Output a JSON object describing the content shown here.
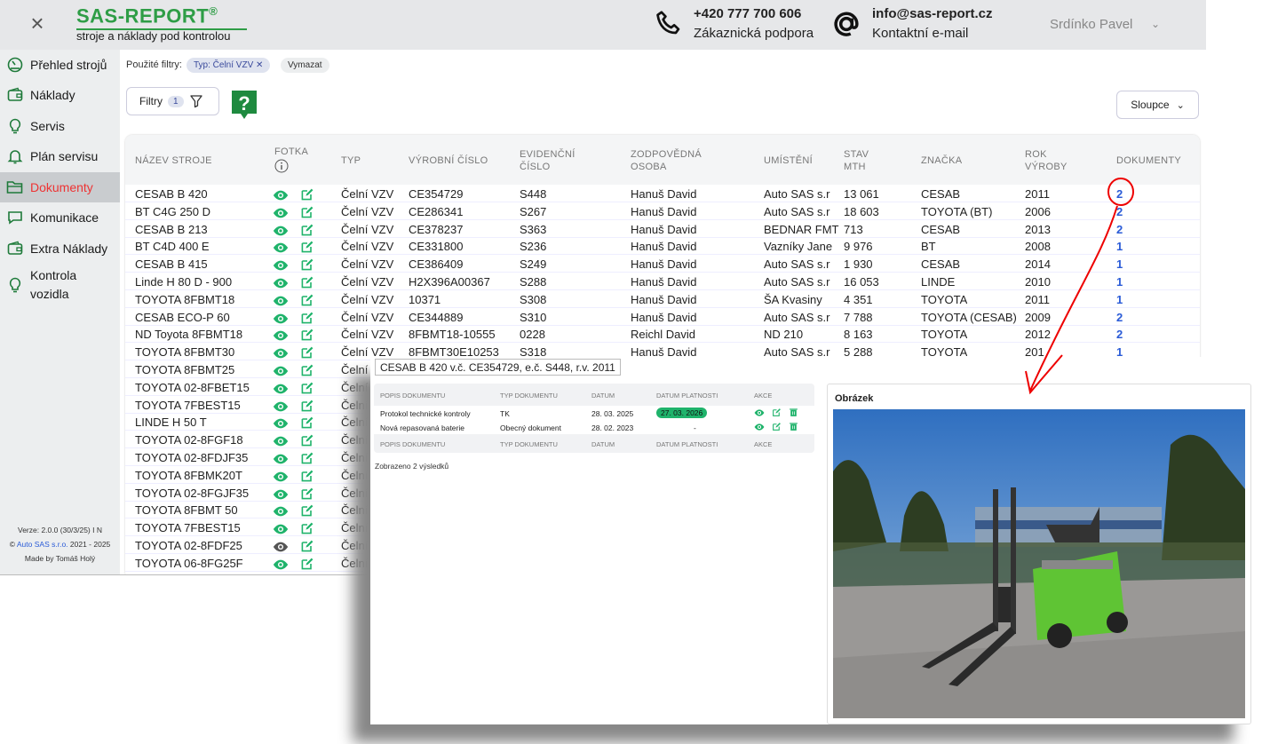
{
  "header": {
    "logo_title": "SAS-REPORT",
    "logo_reg": "®",
    "logo_subtitle": "stroje a náklady pod kontrolou",
    "phone": "+420 777 700 606",
    "phone_label": "Zákaznická podpora",
    "email": "info@sas-report.cz",
    "email_label": "Kontaktní e-mail",
    "user": "Srdínko Pavel"
  },
  "sidebar": {
    "items": [
      {
        "label": "Přehled strojů",
        "icon": "gauge-icon"
      },
      {
        "label": "Náklady",
        "icon": "wallet-icon"
      },
      {
        "label": "Servis",
        "icon": "bulb-icon"
      },
      {
        "label": "Plán servisu",
        "icon": "bell-icon"
      },
      {
        "label": "Dokumenty",
        "icon": "folder-icon",
        "active": true
      },
      {
        "label": "Komunikace",
        "icon": "chat-icon"
      },
      {
        "label": "Extra Náklady",
        "icon": "wallet-icon"
      },
      {
        "label": "Kontrola vozidla",
        "icon": "bulb-icon"
      }
    ],
    "version": "Verze: 2.0.0 (30/3/25) I N",
    "copyright_prefix": "©",
    "copyright_link": "Auto SAS s.r.o.",
    "copyright_years": "2021 - 2025",
    "made_by": "Made by Tomáš Holý"
  },
  "filters": {
    "label": "Použité filtry:",
    "chip": "Typ: Čelní VZV",
    "clear": "Vymazat",
    "button": "Filtry",
    "count": "1",
    "columns_button": "Sloupce"
  },
  "table": {
    "headers": {
      "name": "NÁZEV STROJE",
      "photo": "FOTKA",
      "type": "TYP",
      "serial": "VÝROBNÍ ČÍSLO",
      "evid1": "EVIDENČNÍ",
      "evid2": "ČÍSLO",
      "resp1": "ZODPOVĚDNÁ",
      "resp2": "OSOBA",
      "location": "UMÍSTĚNÍ",
      "mth1": "STAV",
      "mth2": "MTH",
      "brand": "ZNAČKA",
      "year1": "ROK",
      "year2": "VÝROBY",
      "docs": "DOKUMENTY"
    },
    "rows": [
      {
        "name": "CESAB B 420",
        "type": "Čelní VZV",
        "serial": "CE354729",
        "evid": "S448",
        "person": "Hanuš David",
        "location": "Auto SAS s.r",
        "mth": "13 061",
        "brand": "CESAB",
        "year": "2011",
        "docs": "2"
      },
      {
        "name": "BT C4G 250 D",
        "type": "Čelní VZV",
        "serial": "CE286341",
        "evid": "S267",
        "person": "Hanuš David",
        "location": "Auto SAS s.r",
        "mth": "18 603",
        "brand": "TOYOTA (BT)",
        "year": "2006",
        "docs": "2"
      },
      {
        "name": "CESAB B 213",
        "type": "Čelní VZV",
        "serial": "CE378237",
        "evid": "S363",
        "person": "Hanuš David",
        "location": "BEDNAR FMT s",
        "mth": "713",
        "brand": "CESAB",
        "year": "2013",
        "docs": "2"
      },
      {
        "name": "BT C4D 400 E",
        "type": "Čelní VZV",
        "serial": "CE331800",
        "evid": "S236",
        "person": "Hanuš David",
        "location": "Vazníky Jane",
        "mth": "9 976",
        "brand": "BT",
        "year": "2008",
        "docs": "1"
      },
      {
        "name": "CESAB B 415",
        "type": "Čelní VZV",
        "serial": "CE386409",
        "evid": "S249",
        "person": "Hanuš David",
        "location": "Auto SAS s.r",
        "mth": "1 930",
        "brand": "CESAB",
        "year": "2014",
        "docs": "1"
      },
      {
        "name": "Linde H 80 D - 900",
        "type": "Čelní VZV",
        "serial": "H2X396A00367",
        "evid": "S288",
        "person": "Hanuš David",
        "location": "Auto SAS s.r",
        "mth": "16 053",
        "brand": "LINDE",
        "year": "2010",
        "docs": "1"
      },
      {
        "name": "TOYOTA 8FBMT18",
        "type": "Čelní VZV",
        "serial": "10371",
        "evid": "S308",
        "person": "Hanuš David",
        "location": "ŠA Kvasiny",
        "mth": "4 351",
        "brand": "TOYOTA",
        "year": "2011",
        "docs": "1"
      },
      {
        "name": "CESAB ECO-P 60",
        "type": "Čelní VZV",
        "serial": "CE344889",
        "evid": "S310",
        "person": "Hanuš David",
        "location": "Auto SAS s.r",
        "mth": "7 788",
        "brand": "TOYOTA (CESAB)",
        "year": "2009",
        "docs": "2"
      },
      {
        "name": "ND Toyota 8FBMT18",
        "type": "Čelní VZV",
        "serial": "8FBMT18-10555",
        "evid": "0228",
        "person": "Reichl David",
        "location": "ND 210",
        "mth": "8 163",
        "brand": "TOYOTA",
        "year": "2012",
        "docs": "2"
      },
      {
        "name": "TOYOTA 8FBMT30",
        "type": "Čelní VZV",
        "serial": "8FBMT30E10253",
        "evid": "S318",
        "person": "Hanuš David",
        "location": "Auto SAS s.r",
        "mth": "5 288",
        "brand": "TOYOTA",
        "year": "201",
        "docs": "1"
      },
      {
        "name": "TOYOTA 8FBMT25",
        "type": "Čelní V"
      },
      {
        "name": "TOYOTA 02-8FBET15",
        "type": "Čelní"
      },
      {
        "name": "TOYOTA 7FBEST15",
        "type": "Čelní"
      },
      {
        "name": "LINDE H 50 T",
        "type": "Čelní"
      },
      {
        "name": "TOYOTA 02-8FGF18",
        "type": "Čelní"
      },
      {
        "name": "TOYOTA 02-8FDJF35",
        "type": "Čelní"
      },
      {
        "name": "TOYOTA 8FBMK20T",
        "type": "Čelní"
      },
      {
        "name": "TOYOTA 02-8FGJF35",
        "type": "Čelní"
      },
      {
        "name": "TOYOTA 8FBMT 50",
        "type": "Čelní"
      },
      {
        "name": "TOYOTA 7FBEST15",
        "type": "Čelní"
      },
      {
        "name": "TOYOTA 02-8FDF25",
        "type": "Čelní"
      },
      {
        "name": "TOYOTA 06-8FG25F",
        "type": "Čelní"
      }
    ]
  },
  "detail": {
    "title": "CESAB B 420 v.č. CE354729, e.č. S448, r.v. 2011",
    "headers": {
      "desc": "POPIS DOKUMENTU",
      "type": "TYP DOKUMENTU",
      "date": "DATUM",
      "valid": "DATUM PLATNOSTI",
      "actions": "AKCE"
    },
    "rows": [
      {
        "desc": "Protokol technické kontroly",
        "type": "TK",
        "date": "28. 03. 2025",
        "valid": "27. 03. 2026"
      },
      {
        "desc": "Nová repasovaná baterie",
        "type": "Obecný dokument",
        "date": "28. 02. 2023",
        "valid": "-"
      }
    ],
    "summary": "Zobrazeno 2 výsledků",
    "image_title": "Obrázek"
  },
  "colors": {
    "brand": "#2e9d46",
    "accent_blue": "#2a5bd7",
    "active_nav": "#e33",
    "valid_badge": "#1fb36b"
  }
}
